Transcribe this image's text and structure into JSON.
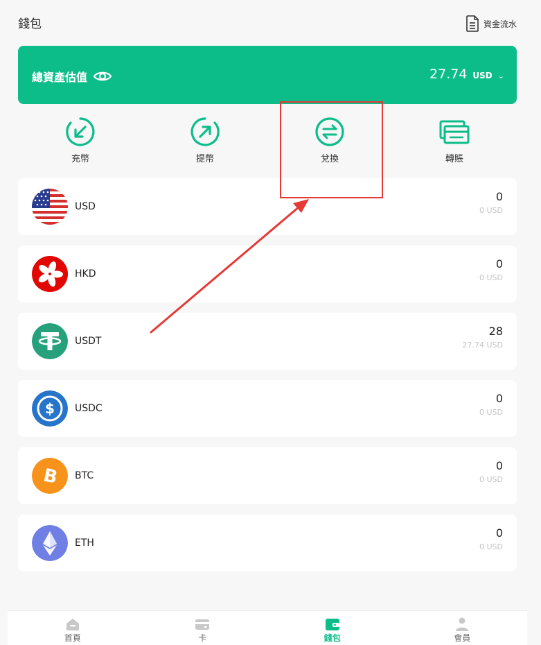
{
  "header": {
    "title": "錢包",
    "ledger_label": "資金流水"
  },
  "balance": {
    "label": "總資產估值",
    "value": "27.74",
    "currency": "USD"
  },
  "actions": [
    {
      "label": "充幣"
    },
    {
      "label": "提幣"
    },
    {
      "label": "兌換"
    },
    {
      "label": "轉賬"
    }
  ],
  "assets": [
    {
      "code": "USD",
      "amount": "0",
      "usd_value": "0 USD"
    },
    {
      "code": "HKD",
      "amount": "0",
      "usd_value": "0 USD"
    },
    {
      "code": "USDT",
      "amount": "28",
      "usd_value": "27.74 USD"
    },
    {
      "code": "USDC",
      "amount": "0",
      "usd_value": "0 USD"
    },
    {
      "code": "BTC",
      "amount": "0",
      "usd_value": "0 USD"
    },
    {
      "code": "ETH",
      "amount": "0",
      "usd_value": "0 USD"
    }
  ],
  "nav": [
    {
      "label": "首頁"
    },
    {
      "label": "卡"
    },
    {
      "label": "錢包"
    },
    {
      "label": "會員"
    }
  ],
  "colors": {
    "accent": "#0cbd8a",
    "annotation": "#e53935"
  }
}
